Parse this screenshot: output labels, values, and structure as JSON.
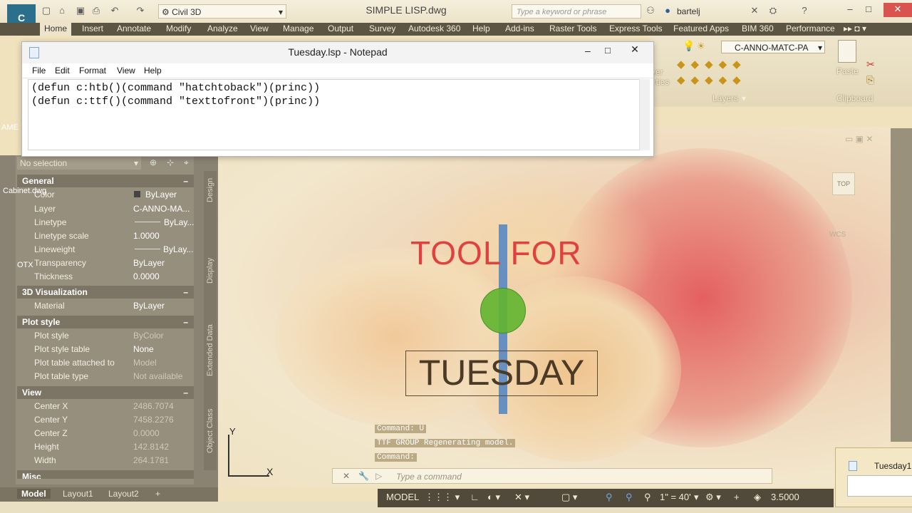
{
  "titlebar": {
    "workspace": "Civil 3D",
    "document_title": "SIMPLE LISP.dwg",
    "search_placeholder": "Type a keyword or phrase",
    "user": "bartelj"
  },
  "ribbon": {
    "tabs": [
      "Home",
      "Insert",
      "Annotate",
      "Modify",
      "Analyze",
      "View",
      "Manage",
      "Output",
      "Survey",
      "Autodesk 360",
      "Help",
      "Add-ins",
      "Raster Tools",
      "Express Tools",
      "Featured Apps",
      "BIM 360",
      "Performance"
    ],
    "active_tab": "Home",
    "layer_combo": "C-ANNO-MATC-PA",
    "panel_layers": "Layers",
    "panel_clipboard": "Clipboard",
    "paste": "Paste",
    "layer_properties_partial": "yer",
    "layer_properties_partial2": "erties"
  },
  "notepad": {
    "title": "Tuesday.lsp - Notepad",
    "menu": [
      "File",
      "Edit",
      "Format",
      "View",
      "Help"
    ],
    "lines": [
      "(defun c:htb()(command \"hatchtoback\")(princ))",
      "(defun c:ttf()(command \"texttofront\")(princ))"
    ]
  },
  "properties": {
    "selection": "No selection",
    "sections": {
      "general": {
        "title": "General",
        "rows": [
          {
            "label": "Color",
            "value": "ByLayer"
          },
          {
            "label": "Layer",
            "value": "C-ANNO-MA..."
          },
          {
            "label": "Linetype",
            "value": "ByLay..."
          },
          {
            "label": "Linetype scale",
            "value": "1.0000"
          },
          {
            "label": "Lineweight",
            "value": "ByLay..."
          },
          {
            "label": "Transparency",
            "value": "ByLayer"
          },
          {
            "label": "Thickness",
            "value": "0.0000"
          }
        ]
      },
      "viz": {
        "title": "3D Visualization",
        "rows": [
          {
            "label": "Material",
            "value": "ByLayer"
          }
        ]
      },
      "plot": {
        "title": "Plot style",
        "rows": [
          {
            "label": "Plot style",
            "value": "ByColor"
          },
          {
            "label": "Plot style table",
            "value": "None"
          },
          {
            "label": "Plot table attached to",
            "value": "Model"
          },
          {
            "label": "Plot table type",
            "value": "Not available"
          }
        ]
      },
      "view": {
        "title": "View",
        "rows": [
          {
            "label": "Center X",
            "value": "2486.7074"
          },
          {
            "label": "Center Y",
            "value": "7458.2276"
          },
          {
            "label": "Center Z",
            "value": "0.0000"
          },
          {
            "label": "Height",
            "value": "142.8142"
          },
          {
            "label": "Width",
            "value": "264.1781"
          }
        ]
      },
      "misc": {
        "title": "Misc"
      }
    },
    "vertical_tabs": [
      "Design",
      "Display",
      "Extended Data",
      "Object Class"
    ],
    "collapse_symbol": "–"
  },
  "drawing": {
    "text_top": "TOOL FOR",
    "text_box": "TUESDAY",
    "viewcube_top": "TOP",
    "wcs": "WCS",
    "ucs_x": "X",
    "ucs_y": "Y"
  },
  "command": {
    "history": [
      "Command: U",
      "TTF GROUP Regenerating model.",
      "Command:"
    ],
    "placeholder": "Type a command"
  },
  "layouts": {
    "tabs": [
      "Model",
      "Layout1",
      "Layout2"
    ],
    "add": "+"
  },
  "status": {
    "model": "MODEL",
    "scale": "1\" = 40'",
    "value": "3.5000"
  },
  "taskbar_preview": {
    "title": "Tuesday1."
  },
  "left_fragments": {
    "cabinet": "Cabinet.dwg",
    "otx": "OTX",
    "ame": "AME"
  },
  "colors": {
    "accent_text": "#e0413f",
    "circle_green": "#62b52f",
    "axis_blue": "#4f84c4"
  }
}
